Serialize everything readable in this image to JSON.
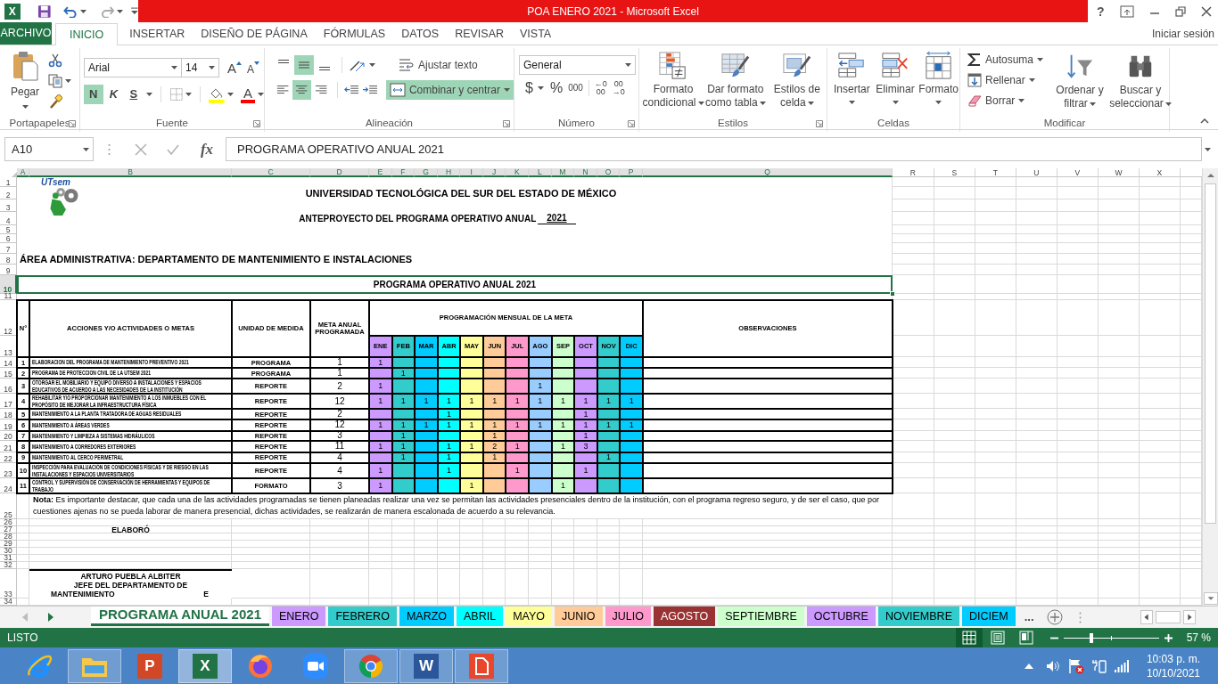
{
  "title_bar": {
    "app_letter": "X",
    "title": "POA ENERO 2021 - Microsoft Excel",
    "help": "?"
  },
  "ribbon_tabs": [
    {
      "label": "ARCHIVO",
      "kind": "file",
      "selected": false
    },
    {
      "label": "INICIO",
      "kind": "tab",
      "selected": true
    },
    {
      "label": "INSERTAR",
      "kind": "tab",
      "selected": false
    },
    {
      "label": "DISEÑO DE PÁGINA",
      "kind": "tab",
      "selected": false
    },
    {
      "label": "FÓRMULAS",
      "kind": "tab",
      "selected": false
    },
    {
      "label": "DATOS",
      "kind": "tab",
      "selected": false
    },
    {
      "label": "REVISAR",
      "kind": "tab",
      "selected": false
    },
    {
      "label": "VISTA",
      "kind": "tab",
      "selected": false
    }
  ],
  "account": "Iniciar sesión",
  "ribbon": {
    "clipboard": {
      "label": "Portapapeles",
      "paste": "Pegar"
    },
    "font": {
      "label": "Fuente",
      "name": "Arial",
      "size": "14",
      "grow": "A",
      "shrink": "A",
      "styles": [
        {
          "label": "N",
          "kind": "bold",
          "selected": true
        },
        {
          "label": "K",
          "kind": "italic",
          "selected": false
        },
        {
          "label": "S",
          "kind": "underline",
          "selected": false
        }
      ],
      "font_color": "A"
    },
    "alignment": {
      "label": "Alineación",
      "vertical": [
        {
          "kind": "top",
          "selected": false
        },
        {
          "kind": "middle",
          "selected": true
        },
        {
          "kind": "bottom",
          "selected": false
        }
      ],
      "horizontal": [
        {
          "kind": "left",
          "selected": false
        },
        {
          "kind": "center",
          "selected": true
        },
        {
          "kind": "right",
          "selected": false
        }
      ],
      "wrap": "Ajustar texto",
      "merge": {
        "label": "Combinar y centrar",
        "selected": true
      }
    },
    "number": {
      "label": "Número",
      "format": "General",
      "currency": "$",
      "percent": "%",
      "thousands": "000",
      "decimals": [
        {
          "lines": [
            "←0",
            "00"
          ]
        },
        {
          "lines": [
            "00",
            "→0"
          ]
        }
      ]
    },
    "styles": {
      "label": "Estilos",
      "buttons": [
        {
          "kind": "conditional",
          "lines": [
            "Formato",
            "condicional"
          ]
        },
        {
          "kind": "table",
          "lines": [
            "Dar formato",
            "como tabla"
          ]
        },
        {
          "kind": "cell",
          "lines": [
            "Estilos de",
            "celda"
          ]
        }
      ]
    },
    "cells": {
      "label": "Celdas",
      "buttons": [
        {
          "kind": "insert",
          "label": "Insertar"
        },
        {
          "kind": "delete",
          "label": "Eliminar"
        },
        {
          "kind": "format",
          "label": "Formato"
        }
      ]
    },
    "editing": {
      "label": "Modificar",
      "small": [
        {
          "kind": "sum",
          "label": "Autosuma"
        },
        {
          "kind": "fill",
          "label": "Rellenar"
        },
        {
          "kind": "clear",
          "label": "Borrar"
        }
      ],
      "buttons": [
        {
          "kind": "sort",
          "lines": [
            "Ordenar y",
            "filtrar"
          ]
        },
        {
          "kind": "find",
          "lines": [
            "Buscar y",
            "seleccionar"
          ]
        }
      ]
    }
  },
  "formula_bar": {
    "name_box": "A10",
    "function_label": "fx",
    "formula": "PROGRAMA OPERATIVO ANUAL 2021"
  },
  "sheet": {
    "columns": [
      {
        "label": "A",
        "selected": true
      },
      {
        "label": "B",
        "selected": true
      },
      {
        "label": "C",
        "selected": true
      },
      {
        "label": "D",
        "selected": true
      },
      {
        "label": "E",
        "selected": true
      },
      {
        "label": "F",
        "selected": true
      },
      {
        "label": "G",
        "selected": true
      },
      {
        "label": "H",
        "selected": true
      },
      {
        "label": "I",
        "selected": true
      },
      {
        "label": "J",
        "selected": true
      },
      {
        "label": "K",
        "selected": true
      },
      {
        "label": "L",
        "selected": true
      },
      {
        "label": "M",
        "selected": true
      },
      {
        "label": "N",
        "selected": true
      },
      {
        "label": "O",
        "selected": true
      },
      {
        "label": "P",
        "selected": true
      },
      {
        "label": "Q",
        "selected": true
      },
      {
        "label": "R",
        "selected": false
      },
      {
        "label": "S",
        "selected": false
      },
      {
        "label": "T",
        "selected": false
      },
      {
        "label": "U",
        "selected": false
      },
      {
        "label": "V",
        "selected": false
      },
      {
        "label": "W",
        "selected": false
      },
      {
        "label": "X",
        "selected": false
      }
    ],
    "rows": [
      {
        "label": "1",
        "selected": false
      },
      {
        "label": "2",
        "selected": false
      },
      {
        "label": "3",
        "selected": false
      },
      {
        "label": "4",
        "selected": false
      },
      {
        "label": "5",
        "selected": false
      },
      {
        "label": "6",
        "selected": false
      },
      {
        "label": "7",
        "selected": false
      },
      {
        "label": "8",
        "selected": false
      },
      {
        "label": "9",
        "selected": false
      },
      {
        "label": "10",
        "selected": true
      },
      {
        "label": "11",
        "selected": false
      },
      {
        "label": "12",
        "selected": false
      },
      {
        "label": "13",
        "selected": false
      },
      {
        "label": "14",
        "selected": false
      },
      {
        "label": "15",
        "selected": false
      },
      {
        "label": "16",
        "selected": false
      },
      {
        "label": "17",
        "selected": false
      },
      {
        "label": "18",
        "selected": false
      },
      {
        "label": "19",
        "selected": false
      },
      {
        "label": "20",
        "selected": false
      },
      {
        "label": "21",
        "selected": false
      },
      {
        "label": "22",
        "selected": false
      },
      {
        "label": "23",
        "selected": false
      },
      {
        "label": "24",
        "selected": false
      },
      {
        "label": "25",
        "selected": false
      },
      {
        "label": "26",
        "selected": false
      },
      {
        "label": "27",
        "selected": false
      },
      {
        "label": "28",
        "selected": false
      },
      {
        "label": "29",
        "selected": false
      },
      {
        "label": "30",
        "selected": false
      },
      {
        "label": "31",
        "selected": false
      },
      {
        "label": "32",
        "selected": false
      },
      {
        "label": "33",
        "selected": false
      },
      {
        "label": "34",
        "selected": false
      }
    ],
    "logo": "UTsem",
    "institution": "UNIVERSIDAD TECNOLÓGICA DEL SUR DEL ESTADO DE MÉXICO",
    "subtitle": "ANTEPROYECTO DEL PROGRAMA OPERATIVO ANUAL",
    "year": "2021",
    "area": "ÁREA ADMINISTRATIVA: DEPARTAMENTO DE MANTENIMIENTO E INSTALACIONES",
    "program_title": {
      "text": "PROGRAMA OPERATIVO ANUAL 2021",
      "selected": true
    },
    "table": {
      "headers": {
        "number": "N°",
        "actions": "ACCIONES Y/O ACTIVIDADES O  METAS",
        "unit": "UNIDAD DE MEDIDA",
        "goal": "META ANUAL PROGRAMADA",
        "monthly": "PROGRAMACIÓN MENSUAL DE LA META",
        "notes": "OBSERVACIONES"
      },
      "months": [
        {
          "label": "ENE",
          "color": "#cc99ff"
        },
        {
          "label": "FEB",
          "color": "#33cccc"
        },
        {
          "label": "MAR",
          "color": "#00ccff"
        },
        {
          "label": "ABR",
          "color": "#00ffff"
        },
        {
          "label": "MAY",
          "color": "#ffff99"
        },
        {
          "label": "JUN",
          "color": "#ffcc99"
        },
        {
          "label": "JUL",
          "color": "#ff99cc"
        },
        {
          "label": "AGO",
          "color": "#99ccff"
        },
        {
          "label": "SEP",
          "color": "#ccffcc"
        },
        {
          "label": "OCT",
          "color": "#cc99ff"
        },
        {
          "label": "NOV",
          "color": "#33cccc"
        },
        {
          "label": "DIC",
          "color": "#00ccff"
        }
      ],
      "rows": [
        {
          "number": "1",
          "action": "ELABORACION DEL PROGRAMA DE MANTENIMIENTO PREVENTIVO 2021",
          "unit": "PROGRAMA",
          "goal": "1",
          "months": [
            {
              "color": "#cc99ff",
              "value": "1"
            },
            {
              "color": "#33cccc"
            },
            {
              "color": "#00ccff"
            },
            {
              "color": "#00ffff"
            },
            {
              "color": "#ffff99"
            },
            {
              "color": "#ffcc99"
            },
            {
              "color": "#ff99cc"
            },
            {
              "color": "#99ccff"
            },
            {
              "color": "#ccffcc"
            },
            {
              "color": "#cc99ff"
            },
            {
              "color": "#33cccc"
            },
            {
              "color": "#00ccff"
            }
          ]
        },
        {
          "number": "2",
          "action": "PROGRAMA DE PROTECCION CIVIL DE LA UTSEM 2021",
          "unit": "PROGRAMA",
          "goal": "1",
          "months": [
            {
              "color": "#cc99ff"
            },
            {
              "color": "#33cccc",
              "value": "1"
            },
            {
              "color": "#00ccff"
            },
            {
              "color": "#00ffff"
            },
            {
              "color": "#ffff99"
            },
            {
              "color": "#ffcc99"
            },
            {
              "color": "#ff99cc"
            },
            {
              "color": "#99ccff"
            },
            {
              "color": "#ccffcc"
            },
            {
              "color": "#cc99ff"
            },
            {
              "color": "#33cccc"
            },
            {
              "color": "#00ccff"
            }
          ]
        },
        {
          "number": "3",
          "action": "OTORGAR EL MOBILIARIO Y EQUIPO DIVERSO A INSTALACIONES Y ESPACIOS EDUCATIVOS DE ACUERDO A LAS NECESIDADES DE LA INSTITUCIÓN",
          "unit": "REPORTE",
          "goal": "2",
          "months": [
            {
              "color": "#cc99ff",
              "value": "1"
            },
            {
              "color": "#33cccc"
            },
            {
              "color": "#00ccff"
            },
            {
              "color": "#00ffff"
            },
            {
              "color": "#ffff99"
            },
            {
              "color": "#ffcc99"
            },
            {
              "color": "#ff99cc"
            },
            {
              "color": "#99ccff",
              "value": "1"
            },
            {
              "color": "#ccffcc"
            },
            {
              "color": "#cc99ff"
            },
            {
              "color": "#33cccc"
            },
            {
              "color": "#00ccff"
            }
          ]
        },
        {
          "number": "4",
          "action": "REHABILITAR Y/O PROPORCIONAR MANTENIMIENTO A LOS INMUEBLES CON EL PROPÓSITO DE MEJORAR LA INFRAESTRUCTURA FÍSICA",
          "unit": "REPORTE",
          "goal": "12",
          "months": [
            {
              "color": "#cc99ff",
              "value": "1"
            },
            {
              "color": "#33cccc",
              "value": "1"
            },
            {
              "color": "#00ccff",
              "value": "1"
            },
            {
              "color": "#00ffff",
              "value": "1"
            },
            {
              "color": "#ffff99",
              "value": "1"
            },
            {
              "color": "#ffcc99",
              "value": "1"
            },
            {
              "color": "#ff99cc",
              "value": "1"
            },
            {
              "color": "#99ccff",
              "value": "1"
            },
            {
              "color": "#ccffcc",
              "value": "1"
            },
            {
              "color": "#cc99ff",
              "value": "1"
            },
            {
              "color": "#33cccc",
              "value": "1"
            },
            {
              "color": "#00ccff",
              "value": "1"
            }
          ]
        },
        {
          "number": "5",
          "action": "MANTENIMIENTO A LA PLANTA TRATADORA DE AGUAS RESIDUALES",
          "unit": "REPORTE",
          "goal": "2",
          "months": [
            {
              "color": "#cc99ff"
            },
            {
              "color": "#33cccc"
            },
            {
              "color": "#00ccff"
            },
            {
              "color": "#00ffff",
              "value": "1"
            },
            {
              "color": "#ffff99"
            },
            {
              "color": "#ffcc99"
            },
            {
              "color": "#ff99cc"
            },
            {
              "color": "#99ccff"
            },
            {
              "color": "#ccffcc"
            },
            {
              "color": "#cc99ff",
              "value": "1"
            },
            {
              "color": "#33cccc"
            },
            {
              "color": "#00ccff"
            }
          ]
        },
        {
          "number": "6",
          "action": "MANTENIMIENTO A ÁREAS VERDES",
          "unit": "REPORTE",
          "goal": "12",
          "months": [
            {
              "color": "#cc99ff",
              "value": "1"
            },
            {
              "color": "#33cccc",
              "value": "1"
            },
            {
              "color": "#00ccff",
              "value": "1"
            },
            {
              "color": "#00ffff",
              "value": "1"
            },
            {
              "color": "#ffff99",
              "value": "1"
            },
            {
              "color": "#ffcc99",
              "value": "1"
            },
            {
              "color": "#ff99cc",
              "value": "1"
            },
            {
              "color": "#99ccff",
              "value": "1"
            },
            {
              "color": "#ccffcc",
              "value": "1"
            },
            {
              "color": "#cc99ff",
              "value": "1"
            },
            {
              "color": "#33cccc",
              "value": "1"
            },
            {
              "color": "#00ccff",
              "value": "1"
            }
          ]
        },
        {
          "number": "7",
          "action": "MANTENIMIENTO Y LIMPIEZA A SISTEMAS HIDRÁULICOS",
          "unit": "REPORTE",
          "goal": "3",
          "months": [
            {
              "color": "#cc99ff"
            },
            {
              "color": "#33cccc",
              "value": "1"
            },
            {
              "color": "#00ccff"
            },
            {
              "color": "#00ffff"
            },
            {
              "color": "#ffff99"
            },
            {
              "color": "#ffcc99",
              "value": "1"
            },
            {
              "color": "#ff99cc"
            },
            {
              "color": "#99ccff"
            },
            {
              "color": "#ccffcc"
            },
            {
              "color": "#cc99ff",
              "value": "1"
            },
            {
              "color": "#33cccc"
            },
            {
              "color": "#00ccff"
            }
          ]
        },
        {
          "number": "8",
          "action": "MANTENIMIENTO A CORREDORES EXTERIORES",
          "unit": "REPORTE",
          "goal": "11",
          "months": [
            {
              "color": "#cc99ff",
              "value": "1"
            },
            {
              "color": "#33cccc",
              "value": "1"
            },
            {
              "color": "#00ccff"
            },
            {
              "color": "#00ffff",
              "value": "1"
            },
            {
              "color": "#ffff99",
              "value": "1"
            },
            {
              "color": "#ffcc99",
              "value": "2"
            },
            {
              "color": "#ff99cc",
              "value": "1"
            },
            {
              "color": "#99ccff"
            },
            {
              "color": "#ccffcc",
              "value": "1"
            },
            {
              "color": "#cc99ff",
              "value": "3"
            },
            {
              "color": "#33cccc"
            },
            {
              "color": "#00ccff"
            }
          ]
        },
        {
          "number": "9",
          "action": "MANTENIMIENTO AL CERCO PERIMETRAL",
          "unit": "REPORTE",
          "goal": "4",
          "months": [
            {
              "color": "#cc99ff"
            },
            {
              "color": "#33cccc",
              "value": "1"
            },
            {
              "color": "#00ccff"
            },
            {
              "color": "#00ffff",
              "value": "1"
            },
            {
              "color": "#ffff99"
            },
            {
              "color": "#ffcc99",
              "value": "1"
            },
            {
              "color": "#ff99cc"
            },
            {
              "color": "#99ccff"
            },
            {
              "color": "#ccffcc"
            },
            {
              "color": "#cc99ff"
            },
            {
              "color": "#33cccc",
              "value": "1"
            },
            {
              "color": "#00ccff"
            }
          ]
        },
        {
          "number": "10",
          "action": "INSPECCIÓN PARA EVALUACIÓN DE CONDICIONES FÍSICAS Y DE RIESGO EN LAS INSTALACIONES Y ESPACIOS UNIVERSITARIOS",
          "unit": "REPORTE",
          "goal": "4",
          "months": [
            {
              "color": "#cc99ff",
              "value": "1"
            },
            {
              "color": "#33cccc"
            },
            {
              "color": "#00ccff"
            },
            {
              "color": "#00ffff",
              "value": "1"
            },
            {
              "color": "#ffff99"
            },
            {
              "color": "#ffcc99"
            },
            {
              "color": "#ff99cc",
              "value": "1"
            },
            {
              "color": "#99ccff"
            },
            {
              "color": "#ccffcc"
            },
            {
              "color": "#cc99ff",
              "value": "1"
            },
            {
              "color": "#33cccc"
            },
            {
              "color": "#00ccff"
            }
          ]
        },
        {
          "number": "11",
          "action": "CONTROL Y SUPERVISIÓN DE CONSERVACIÓN DE HERRAMIENTAS Y EQUIPOS DE TRABAJO",
          "unit": "FORMATO",
          "goal": "3",
          "months": [
            {
              "color": "#cc99ff",
              "value": "1"
            },
            {
              "color": "#33cccc"
            },
            {
              "color": "#00ccff"
            },
            {
              "color": "#00ffff"
            },
            {
              "color": "#ffff99",
              "value": "1"
            },
            {
              "color": "#ffcc99"
            },
            {
              "color": "#ff99cc"
            },
            {
              "color": "#99ccff"
            },
            {
              "color": "#ccffcc",
              "value": "1"
            },
            {
              "color": "#cc99ff"
            },
            {
              "color": "#33cccc"
            },
            {
              "color": "#00ccff"
            }
          ]
        }
      ]
    },
    "note": "**Nota:**  Es importante destacar, que cada una de las actividades programadas se tienen planeadas realizar una vez se permitan las actividades presenciales dentro de la institución, con el programa regreso seguro, y de ser el caso, que por cuestiones ajenas no se pueda laborar de manera presencial, dichas actividades, se realizarán de manera escalonada de acuerdo a su relevancia.",
    "prepared_by": "ELABORÓ",
    "signature": {
      "name": "ARTURO PUEBLA ALBITER",
      "title": "JEFE DEL DEPARTAMENTO DE",
      "title_end": [
        "MANTENIMIENTO",
        "E"
      ]
    }
  },
  "sheet_nav": [
    {
      "kind": "prev",
      "disabled": true
    },
    {
      "kind": "next",
      "disabled": false
    }
  ],
  "sheet_tabs": [
    {
      "label": "PROGRAMA ANUAL 2021",
      "selected": true
    },
    {
      "label": "ENERO",
      "color": "#cc99ff",
      "selected": false
    },
    {
      "label": "FEBRERO",
      "color": "#33cccc",
      "selected": false
    },
    {
      "label": "MARZO",
      "color": "#00ccff",
      "selected": false
    },
    {
      "label": "ABRIL",
      "color": "#00ffff",
      "selected": false
    },
    {
      "label": "MAYO",
      "color": "#ffff99",
      "selected": false
    },
    {
      "label": "JUNIO",
      "color": "#ffcc99",
      "selected": false
    },
    {
      "label": "JULIO",
      "color": "#ff99cc",
      "selected": false
    },
    {
      "label": "AGOSTO",
      "color": "#993333",
      "selected": false
    },
    {
      "label": "SEPTIEMBRE",
      "color": "#ccffcc",
      "selected": false
    },
    {
      "label": "OCTUBRE",
      "color": "#cc99ff",
      "selected": false
    },
    {
      "label": "NOVIEMBRE",
      "color": "#33cccc",
      "selected": false
    },
    {
      "label": "DICIEM",
      "color": "#00ccff",
      "selected": false
    }
  ],
  "more_tabs": "...",
  "status_bar": {
    "status": "LISTO",
    "views": [
      {
        "kind": "normal",
        "selected": true
      },
      {
        "kind": "page_layout",
        "selected": false
      },
      {
        "kind": "page_break",
        "selected": false
      }
    ],
    "zoom": {
      "level": 0.29,
      "reading": "57 %"
    }
  },
  "taskbar": {
    "apps": [
      {
        "kind": "ie",
        "open": false,
        "selected": false
      },
      {
        "kind": "explorer",
        "open": true,
        "selected": false
      },
      {
        "kind": "powerpoint",
        "letter": "P",
        "open": false,
        "selected": false
      },
      {
        "kind": "excel",
        "letter": "X",
        "open": true,
        "selected": true
      },
      {
        "kind": "firefox",
        "open": false,
        "selected": false
      },
      {
        "kind": "zoom",
        "open": false,
        "selected": false
      },
      {
        "kind": "chrome",
        "open": true,
        "selected": false
      },
      {
        "kind": "word",
        "letter": "W",
        "open": true,
        "selected": false
      },
      {
        "kind": "pdf",
        "open": true,
        "selected": false
      }
    ],
    "time": "10:03 p. m.",
    "date": "10/10/2021"
  }
}
